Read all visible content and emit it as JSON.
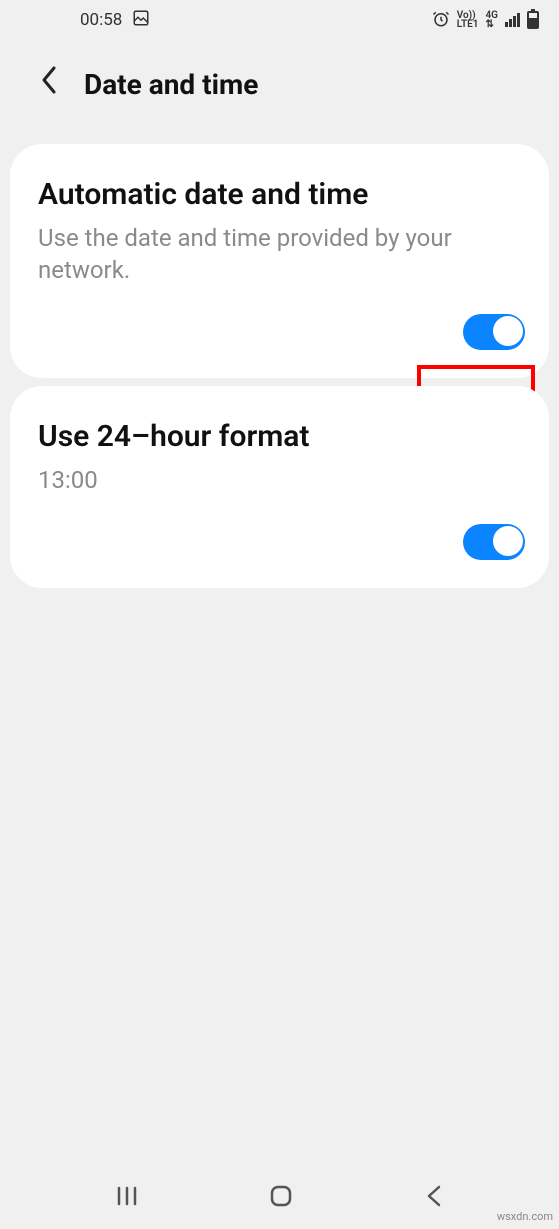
{
  "status": {
    "time": "00:58",
    "vo": "Vo))",
    "lte": "LTE1",
    "net": "4G"
  },
  "header": {
    "title": "Date and time"
  },
  "settings": {
    "auto_title": "Automatic date and time",
    "auto_sub": "Use the date and time provided by your network.",
    "h24_title": "Use 24–hour format",
    "h24_sub": "13:00"
  },
  "watermark": "wsxdn.com"
}
